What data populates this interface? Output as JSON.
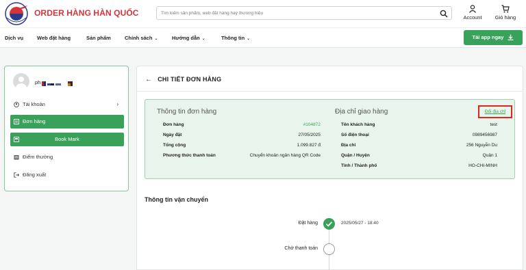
{
  "header": {
    "brand": "ORDER HÀNG HÀN QUỐC",
    "search_placeholder": "Tìm kiếm sản phẩm, web đặt hàng hay thương hiệu",
    "account_label": "Account",
    "cart_label": "Giỏ hàng"
  },
  "nav": {
    "items": [
      "Dịch vụ",
      "Web đặt hàng",
      "Sản phẩm",
      "Chính sách",
      "Hướng dẫn",
      "Thông tin"
    ],
    "app_button": "Tải app ngay"
  },
  "sidebar": {
    "username": "ph",
    "items": [
      {
        "label": "Tài khoản",
        "icon": "user-circle-icon"
      },
      {
        "label": "Đơn hàng",
        "icon": "list-icon"
      },
      {
        "label": "Book Mark",
        "icon": "bookmark-icon"
      },
      {
        "label": "Điểm thưởng",
        "icon": "gift-icon"
      },
      {
        "label": "Đăng xuất",
        "icon": "logout-icon"
      }
    ]
  },
  "main": {
    "title": "CHI TIẾT ĐƠN HÀNG",
    "order_info": {
      "title": "Thông tin đơn hàng",
      "rows": [
        {
          "label": "Đơn hàng",
          "value": "#104872"
        },
        {
          "label": "Ngày đặt",
          "value": "27/05/2025"
        },
        {
          "label": "Tổng cộng",
          "value": "1.099.827 đ"
        },
        {
          "label": "Phương thức thanh toán",
          "value": "Chuyển khoản ngân hàng QR Code"
        }
      ]
    },
    "shipping_address": {
      "title": "Địa chỉ giao hàng",
      "change_link": "Đổi địa chỉ",
      "rows": [
        {
          "label": "Tên khách hàng",
          "value": "test"
        },
        {
          "label": "Số điện thoại",
          "value": "0989456987"
        },
        {
          "label": "Địa chỉ",
          "value": "256 Nguyễn Du"
        },
        {
          "label": "Quận / Huyện",
          "value": "Quận 1"
        },
        {
          "label": "Tỉnh / Thành phố",
          "value": "HO-CHI-MINH"
        }
      ]
    },
    "shipping_status": {
      "title": "Thông tin vận chuyển",
      "steps": [
        {
          "label": "Đặt hàng",
          "time": "2025/05/27 - 18:40",
          "status": "done"
        },
        {
          "label": "Chờ thanh toán",
          "time": "",
          "status": "pending"
        }
      ]
    }
  },
  "colors": {
    "brand_red": "#d4343a",
    "accent_green": "#3aa15a",
    "highlight_red": "#e0251f"
  }
}
